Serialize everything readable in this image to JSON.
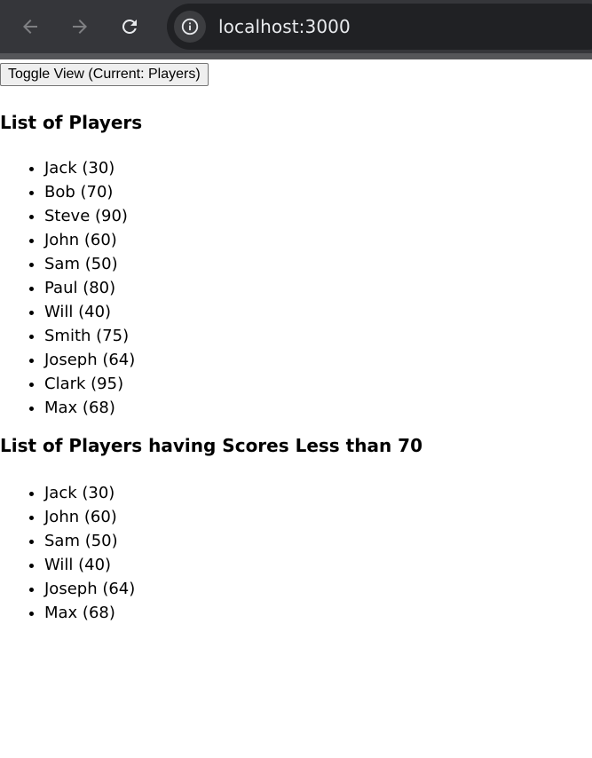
{
  "browser": {
    "url": "localhost:3000",
    "icons": {
      "back": "arrow-left-icon",
      "forward": "arrow-right-icon",
      "reload": "reload-icon",
      "site_info": "info-icon"
    },
    "colors": {
      "toolbar": "#35363a",
      "omnibox": "#202124",
      "text": "#e8eaed"
    }
  },
  "toggle_button": {
    "label": "Toggle View (Current: Players)"
  },
  "players_section": {
    "heading": "List of Players",
    "items": [
      "Jack (30)",
      "Bob (70)",
      "Steve (90)",
      "John (60)",
      "Sam (50)",
      "Paul (80)",
      "Will (40)",
      "Smith (75)",
      "Joseph (64)",
      "Clark (95)",
      "Max (68)"
    ]
  },
  "low_scores_section": {
    "heading": "List of Players having Scores Less than 70",
    "items": [
      "Jack (30)",
      "John (60)",
      "Sam (50)",
      "Will (40)",
      "Joseph (64)",
      "Max (68)"
    ]
  }
}
